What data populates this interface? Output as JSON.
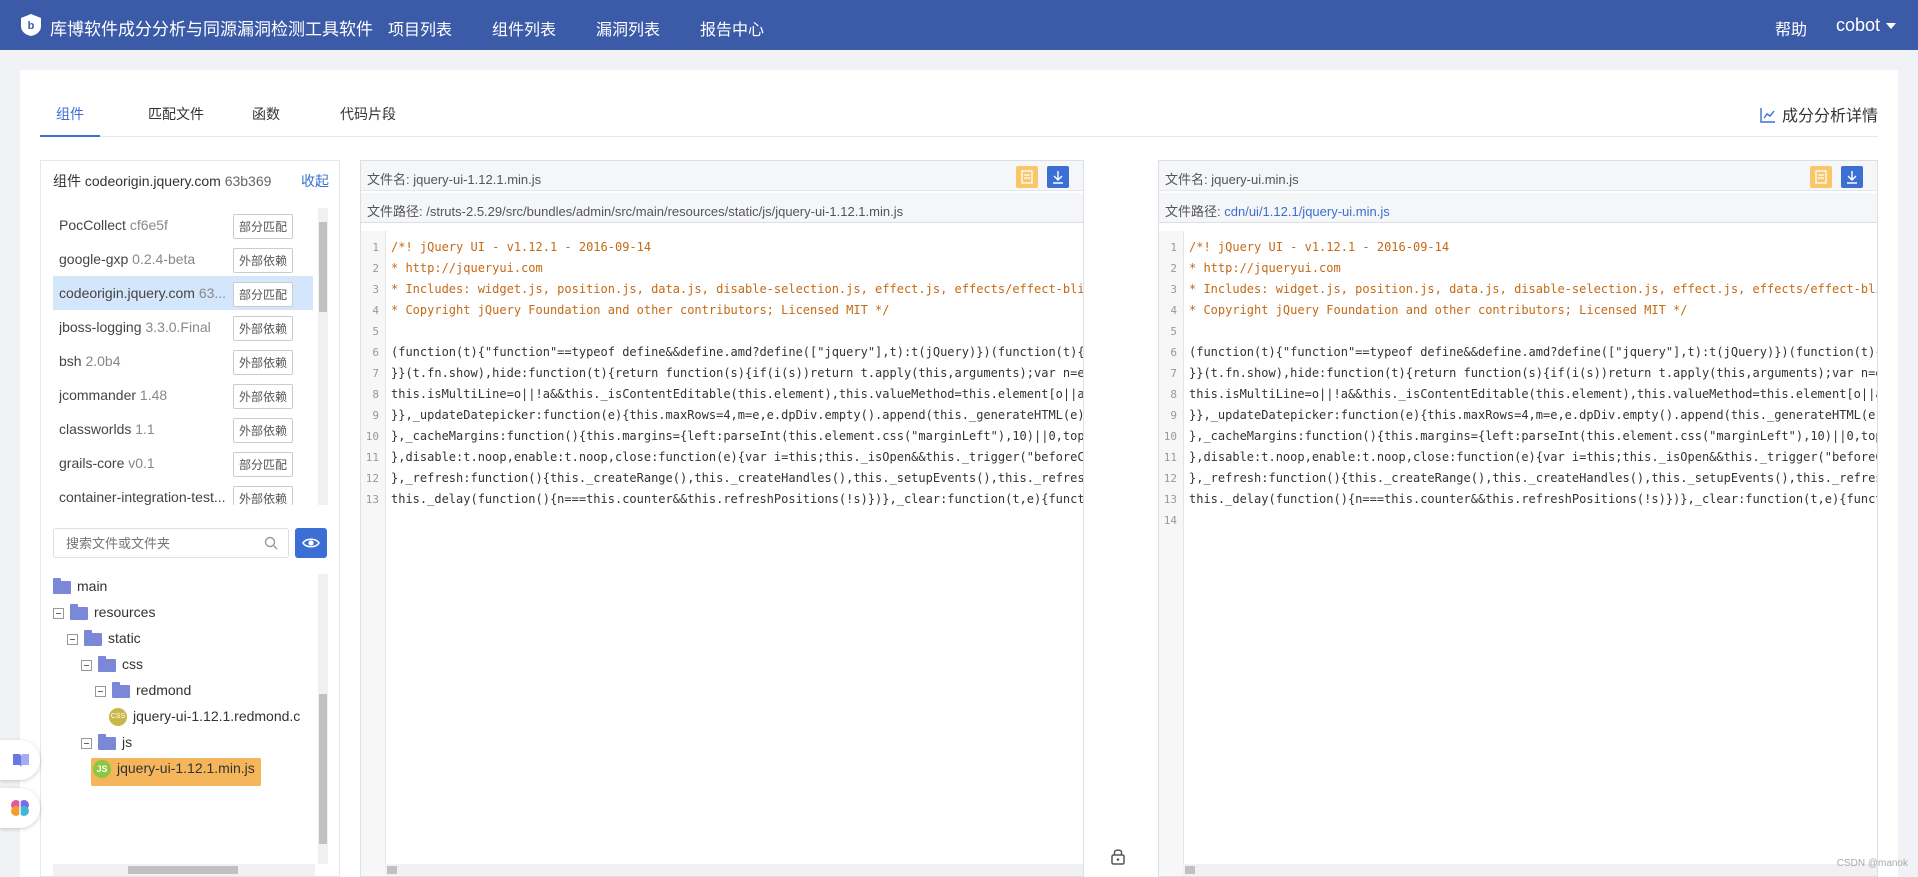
{
  "nav": {
    "app_title": "库博软件成分分析与同源漏洞检测工具软件",
    "menu": [
      "项目列表",
      "组件列表",
      "漏洞列表",
      "报告中心"
    ],
    "help": "帮助",
    "user": "cobot"
  },
  "tabs": [
    "组件",
    "匹配文件",
    "函数",
    "代码片段"
  ],
  "active_tab": "组件",
  "detail_link": "成分分析详情",
  "component_header": {
    "prefix": "组件",
    "name": "codeorigin.jquery.com",
    "version": "63b369",
    "collapse": "收起"
  },
  "components": [
    {
      "name": "PocCollect",
      "version": "cf6e5f",
      "badge": "部分匹配"
    },
    {
      "name": "google-gxp",
      "version": "0.2.4-beta",
      "badge": "外部依赖"
    },
    {
      "name": "codeorigin.jquery.com",
      "version": "63...",
      "badge": "部分匹配",
      "selected": true
    },
    {
      "name": "jboss-logging",
      "version": "3.3.0.Final",
      "badge": "外部依赖"
    },
    {
      "name": "bsh",
      "version": "2.0b4",
      "badge": "外部依赖"
    },
    {
      "name": "jcommander",
      "version": "1.48",
      "badge": "外部依赖"
    },
    {
      "name": "classworlds",
      "version": "1.1",
      "badge": "外部依赖"
    },
    {
      "name": "grails-core",
      "version": "v0.1",
      "badge": "部分匹配"
    },
    {
      "name": "container-integration-test...",
      "version": "",
      "badge": "外部依赖"
    }
  ],
  "search": {
    "placeholder": "搜索文件或文件夹"
  },
  "tree": [
    {
      "label": "main",
      "kind": "folder"
    },
    {
      "label": "resources",
      "kind": "folder"
    },
    {
      "label": "static",
      "kind": "folder"
    },
    {
      "label": "css",
      "kind": "folder"
    },
    {
      "label": "redmond",
      "kind": "folder"
    },
    {
      "label": "jquery-ui-1.12.1.redmond.c",
      "kind": "file"
    },
    {
      "label": "js",
      "kind": "folder"
    },
    {
      "label": "jquery-ui-1.12.1.min.js",
      "kind": "js",
      "selected": true
    }
  ],
  "left_file": {
    "name_label": "文件名:",
    "name": "jquery-ui-1.12.1.min.js",
    "path_label": "文件路径:",
    "path": "/struts-2.5.29/src/bundles/admin/src/main/resources/static/js/jquery-ui-1.12.1.min.js"
  },
  "right_file": {
    "name_label": "文件名:",
    "name": "jquery-ui.min.js",
    "path_label": "文件路径:",
    "path": "cdn/ui/1.12.1/jquery-ui.min.js"
  },
  "code_lines": [
    {
      "n": "1",
      "t": "/*! jQuery UI - v1.12.1 - 2016-09-14",
      "c": true
    },
    {
      "n": "2",
      "t": "* http://jqueryui.com",
      "c": true
    },
    {
      "n": "3",
      "t": "* Includes: widget.js, position.js, data.js, disable-selection.js, effect.js, effects/effect-blind.js",
      "c": true
    },
    {
      "n": "4",
      "t": "* Copyright jQuery Foundation and other contributors; Licensed MIT */",
      "c": true
    },
    {
      "n": "5",
      "t": "",
      "c": false
    },
    {
      "n": "6",
      "t": "(function(t){\"function\"==typeof define&&define.amd?define([\"jquery\"],t):t(jQuery)})(function(t){function",
      "c": false
    },
    {
      "n": "7",
      "t": "}}(t.fn.show),hide:function(t){return function(s){if(i(s))return t.apply(this,arguments);var n=e.apply",
      "c": false
    },
    {
      "n": "8",
      "t": "this.isMultiLine=o||!a&&this._isContentEditable(this.element),this.valueMethod=this.element[o||a?\"val",
      "c": false
    },
    {
      "n": "9",
      "t": "}},_updateDatepicker:function(e){this.maxRows=4,m=e,e.dpDiv.empty().append(this._generateHTML(e)),this",
      "c": false
    },
    {
      "n": "10",
      "t": "},_cacheMargins:function(){this.margins={left:parseInt(this.element.css(\"marginLeft\"),10)||0,top:parse",
      "c": false
    },
    {
      "n": "11",
      "t": "},disable:t.noop,enable:t.noop,close:function(e){var i=this;this._isOpen&&this._trigger(\"beforeClose",
      "c": false
    },
    {
      "n": "12",
      "t": "},_refresh:function(){this._createRange(),this._createHandles(),this._setupEvents(),this._refreshValue",
      "c": false
    },
    {
      "n": "13",
      "t": "this._delay(function(){n===this.counter&&this.refreshPositions(!s)})},_clear:function(t,e){function",
      "c": false
    }
  ],
  "right_extra_line": "14",
  "watermark": "CSDN @manok"
}
